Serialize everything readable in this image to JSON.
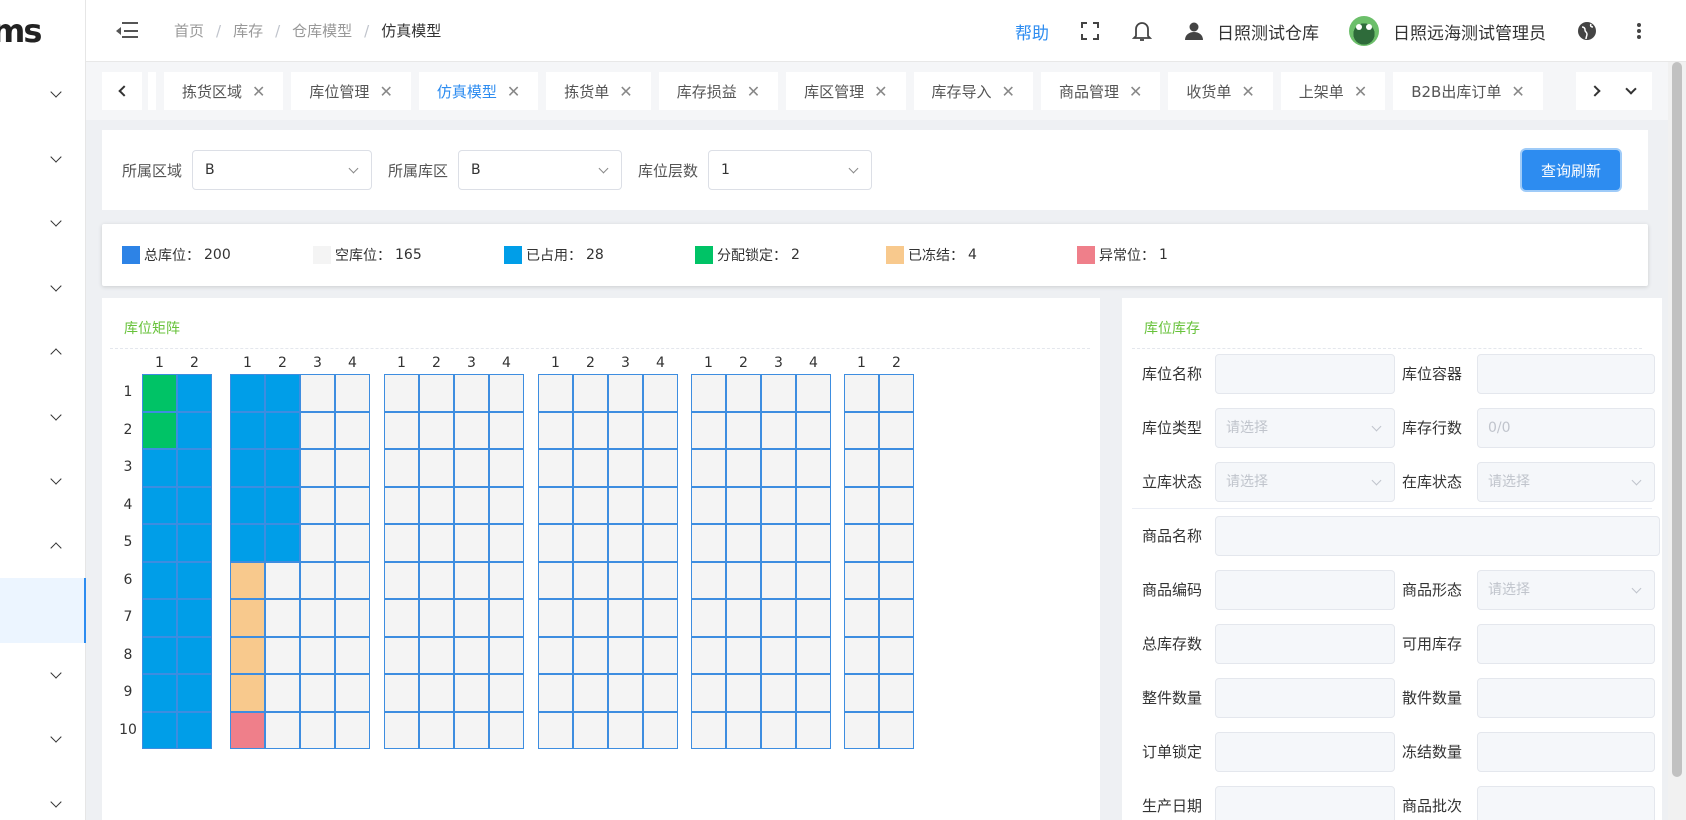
{
  "sidebar": {
    "logo_text": "ms",
    "items": [
      {
        "chevron": "down",
        "active": false
      },
      {
        "chevron": "down",
        "active": false
      },
      {
        "chevron": "down",
        "active": false
      },
      {
        "chevron": "down",
        "active": false
      },
      {
        "chevron": "up",
        "active": false
      },
      {
        "chevron": "down",
        "active": false
      },
      {
        "chevron": "down",
        "active": false
      },
      {
        "chevron": "up",
        "active": false
      },
      {
        "chevron": "none",
        "active": true
      },
      {
        "chevron": "down",
        "active": false
      },
      {
        "chevron": "down",
        "active": false
      },
      {
        "chevron": "down",
        "active": false
      }
    ]
  },
  "header": {
    "breadcrumb": [
      "首页",
      "库存",
      "仓库模型",
      "仿真模型"
    ],
    "help": "帮助",
    "warehouse": "日照测试仓库",
    "user": "日照远海测试管理员"
  },
  "tabs": [
    {
      "label": "拣货区域",
      "active": false
    },
    {
      "label": "库位管理",
      "active": false
    },
    {
      "label": "仿真模型",
      "active": true
    },
    {
      "label": "拣货单",
      "active": false
    },
    {
      "label": "库存损益",
      "active": false
    },
    {
      "label": "库区管理",
      "active": false
    },
    {
      "label": "库存导入",
      "active": false
    },
    {
      "label": "商品管理",
      "active": false
    },
    {
      "label": "收货单",
      "active": false
    },
    {
      "label": "上架单",
      "active": false
    },
    {
      "label": "B2B出库订单",
      "active": false
    }
  ],
  "filter": {
    "area_label": "所属区域",
    "area_value": "B",
    "zone_label": "所属库区",
    "zone_value": "B",
    "level_label": "库位层数",
    "level_value": "1",
    "query_button": "查询刷新"
  },
  "legend": [
    {
      "label": "总库位：",
      "count": "200",
      "color": "#2d83e6"
    },
    {
      "label": "空库位：",
      "count": "165",
      "color": "#f4f4f4"
    },
    {
      "label": "已占用：",
      "count": "28",
      "color": "#009ee8"
    },
    {
      "label": "分配锁定：",
      "count": "2",
      "color": "#00c366"
    },
    {
      "label": "已冻结：",
      "count": "4",
      "color": "#f8c98d"
    },
    {
      "label": "异常位：",
      "count": "1",
      "color": "#ef7f8a"
    }
  ],
  "matrix": {
    "title": "库位矩阵",
    "rows": [
      "1",
      "2",
      "3",
      "4",
      "5",
      "6",
      "7",
      "8",
      "9",
      "10"
    ],
    "blocks": [
      {
        "cols": [
          "1",
          "2"
        ],
        "cells": [
          [
            "lock",
            "occ"
          ],
          [
            "lock",
            "occ"
          ],
          [
            "occ",
            "occ"
          ],
          [
            "occ",
            "occ"
          ],
          [
            "occ",
            "occ"
          ],
          [
            "occ",
            "occ"
          ],
          [
            "occ",
            "occ"
          ],
          [
            "occ",
            "occ"
          ],
          [
            "occ",
            "occ"
          ],
          [
            "occ",
            "occ"
          ]
        ]
      },
      {
        "cols": [
          "1",
          "2",
          "3",
          "4"
        ],
        "cells": [
          [
            "occ",
            "occ",
            "empty",
            "empty"
          ],
          [
            "occ",
            "occ",
            "empty",
            "empty"
          ],
          [
            "occ",
            "occ",
            "empty",
            "empty"
          ],
          [
            "occ",
            "occ",
            "empty",
            "empty"
          ],
          [
            "occ",
            "occ",
            "empty",
            "empty"
          ],
          [
            "frz",
            "empty",
            "empty",
            "empty"
          ],
          [
            "frz",
            "empty",
            "empty",
            "empty"
          ],
          [
            "frz",
            "empty",
            "empty",
            "empty"
          ],
          [
            "frz",
            "empty",
            "empty",
            "empty"
          ],
          [
            "err",
            "empty",
            "empty",
            "empty"
          ]
        ]
      },
      {
        "cols": [
          "1",
          "2",
          "3",
          "4"
        ],
        "cells": "empty"
      },
      {
        "cols": [
          "1",
          "2",
          "3",
          "4"
        ],
        "cells": "empty"
      },
      {
        "cols": [
          "1",
          "2",
          "3",
          "4"
        ],
        "cells": "empty"
      },
      {
        "cols": [
          "1",
          "2"
        ],
        "cells": "empty"
      }
    ]
  },
  "inventory": {
    "title": "库位库存",
    "location_name": "库位名称",
    "location_container": "库位容器",
    "location_type": "库位类型",
    "location_type_placeholder": "请选择",
    "stock_rows": "库存行数",
    "stock_rows_value": "0/0",
    "warehouse_status": "立库状态",
    "warehouse_status_placeholder": "请选择",
    "in_stock_status": "在库状态",
    "in_stock_status_placeholder": "请选择",
    "product_name": "商品名称",
    "product_code": "商品编码",
    "product_form": "商品形态",
    "product_form_placeholder": "请选择",
    "total_stock": "总库存数",
    "available_stock": "可用库存",
    "whole_qty": "整件数量",
    "loose_qty": "散件数量",
    "order_locked": "订单锁定",
    "frozen_qty": "冻结数量",
    "production_date": "生产日期",
    "product_batch": "商品批次"
  }
}
